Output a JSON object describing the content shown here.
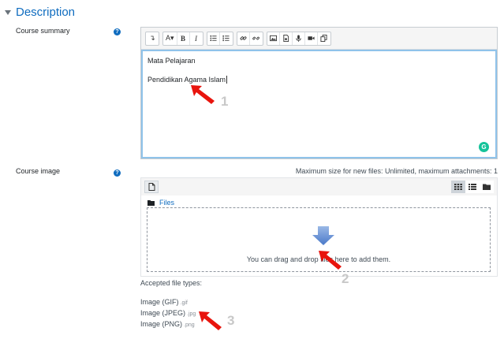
{
  "section": {
    "title": "Description"
  },
  "summary": {
    "label": "Course summary",
    "help": "?",
    "toolbar": {
      "collapse": "↴",
      "font": "A▾",
      "bold": "B",
      "italic": "I"
    },
    "content": {
      "line1": "Mata Pelajaran",
      "line2": "Pendidikan Agama Islam"
    }
  },
  "image": {
    "label": "Course image",
    "help": "?",
    "max_size": "Maximum size for new files: Unlimited, maximum attachments: 1",
    "breadcrumb": "Files",
    "drop_text": "You can drag and drop files here to add them."
  },
  "accepted": {
    "title": "Accepted file types:",
    "types": [
      {
        "name": "Image (GIF)",
        "ext": ".gif"
      },
      {
        "name": "Image (JPEG)",
        "ext": ".jpg"
      },
      {
        "name": "Image (PNG)",
        "ext": ".png"
      }
    ]
  },
  "markers": [
    "1",
    "2",
    "3"
  ],
  "colors": {
    "accent": "#0f6cbf",
    "focus": "#8fc3ea",
    "arrow": "#e8140d",
    "marker": "#c8c8c8"
  }
}
